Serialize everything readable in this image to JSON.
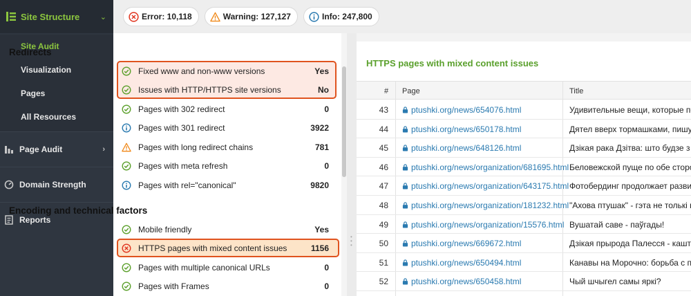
{
  "sidebar": {
    "header": "Site Structure",
    "sub_items": [
      "Site Audit",
      "Visualization",
      "Pages",
      "All Resources"
    ],
    "sections": [
      {
        "label": "Page Audit",
        "icon": "bar-chart-icon",
        "arrow": "›"
      },
      {
        "label": "Domain Strength",
        "icon": "gauge-icon",
        "arrow": ""
      },
      {
        "label": "Reports",
        "icon": "report-icon",
        "arrow": ""
      }
    ]
  },
  "summary": {
    "error": "Error: 10,118",
    "warning": "Warning: 127,127",
    "info": "Info: 247,800"
  },
  "groups": [
    {
      "title": "Redirects",
      "rows": [
        {
          "status": "ok",
          "label": "Fixed www and non-www versions",
          "value": "Yes"
        },
        {
          "status": "ok",
          "label": "Issues with HTTP/HTTPS site versions",
          "value": "No"
        },
        {
          "status": "ok",
          "label": "Pages with 302 redirect",
          "value": "0"
        },
        {
          "status": "info",
          "label": "Pages with 301 redirect",
          "value": "3922"
        },
        {
          "status": "warning",
          "label": "Pages with long redirect chains",
          "value": "781"
        },
        {
          "status": "ok",
          "label": "Pages with meta refresh",
          "value": "0"
        },
        {
          "status": "info",
          "label": "Pages with rel=\"canonical\"",
          "value": "9820"
        }
      ]
    },
    {
      "title": "Encoding and technical factors",
      "rows": [
        {
          "status": "ok",
          "label": "Mobile friendly",
          "value": "Yes"
        },
        {
          "status": "error",
          "label": "HTTPS pages with mixed content issues",
          "value": "1156"
        },
        {
          "status": "ok",
          "label": "Pages with multiple canonical URLs",
          "value": "0"
        },
        {
          "status": "ok",
          "label": "Pages with Frames",
          "value": "0"
        }
      ]
    }
  ],
  "detail": {
    "title": "HTTPS pages with mixed content issues",
    "columns": [
      "#",
      "Page",
      "Title"
    ],
    "rows": [
      {
        "num": "43",
        "page": "ptushki.org/news/654076.html",
        "title": "Удивительные вещи, которые под"
      },
      {
        "num": "44",
        "page": "ptushki.org/news/650178.html",
        "title": "Дятел вверх тормашками, пишуха"
      },
      {
        "num": "45",
        "page": "ptushki.org/news/648126.html",
        "title": "Дзікая рака Дзітва: што будзе з лё"
      },
      {
        "num": "46",
        "page": "ptushki.org/news/organization/681695.html",
        "title": "Беловежской пуще по обе сторон"
      },
      {
        "num": "47",
        "page": "ptushki.org/news/organization/643175.html",
        "title": "Фотобердинг продолжает развива"
      },
      {
        "num": "48",
        "page": "ptushki.org/news/organization/181232.html",
        "title": "\"Ахова птушак\" - гэта не толькі пт"
      },
      {
        "num": "49",
        "page": "ptushki.org/news/organization/15576.html",
        "title": "Вушатай саве - паўгады!"
      },
      {
        "num": "50",
        "page": "ptushki.org/news/669672.html",
        "title": "Дзікая прырода Палесся - каштоўн"
      },
      {
        "num": "51",
        "page": "ptushki.org/news/650494.html",
        "title": "Канавы на Морочно: борьба с пож"
      },
      {
        "num": "52",
        "page": "ptushki.org/news/650458.html",
        "title": "Чый шчыгел самы яркі?"
      }
    ]
  },
  "colors": {
    "ok": "#5ca02c",
    "info": "#2a7ab0",
    "warning": "#f08a1c",
    "error": "#e0331e",
    "accent": "#8cc63f"
  }
}
